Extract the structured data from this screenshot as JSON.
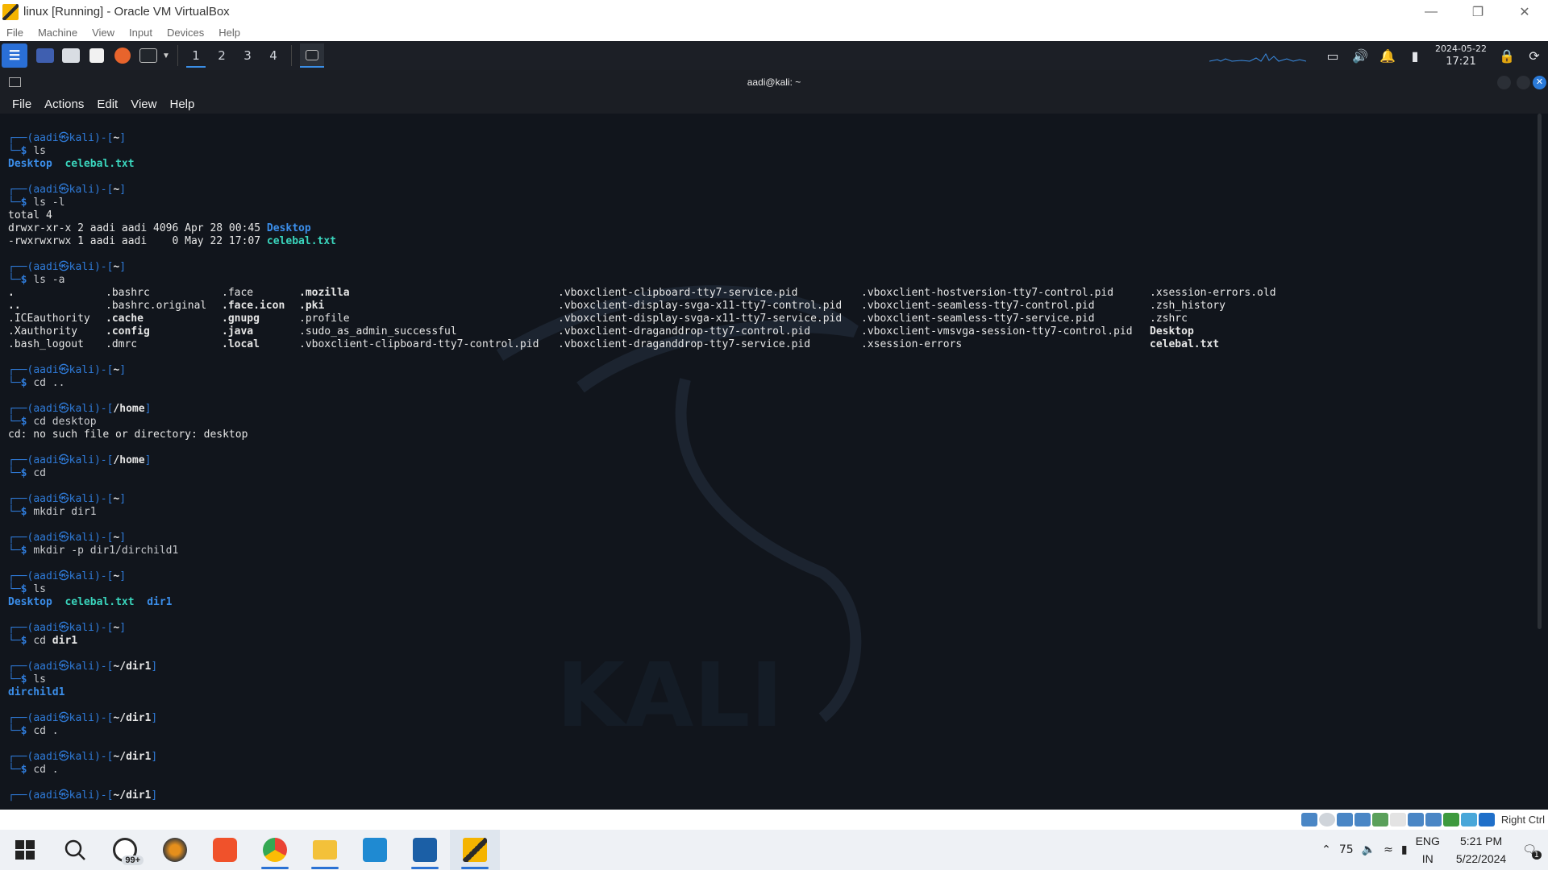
{
  "vbox": {
    "title": "linux [Running] - Oracle VM VirtualBox",
    "menu": [
      "File",
      "Machine",
      "View",
      "Input",
      "Devices",
      "Help"
    ],
    "host_key": "Right Ctrl"
  },
  "kali_panel": {
    "workspaces": [
      "1",
      "2",
      "3",
      "4"
    ],
    "date": "2024-05-22",
    "time": "17:21"
  },
  "terminal": {
    "title": "aadi@kali: ~",
    "menu": [
      "File",
      "Actions",
      "Edit",
      "View",
      "Help"
    ],
    "lines": [
      {
        "type": "prompt",
        "path": "~"
      },
      {
        "type": "cmd",
        "text": "ls"
      },
      {
        "type": "out_ls1"
      },
      {
        "type": "blank"
      },
      {
        "type": "prompt",
        "path": "~"
      },
      {
        "type": "cmd",
        "text": "ls -l"
      },
      {
        "type": "text",
        "text": "total 4"
      },
      {
        "type": "ll1",
        "text": "drwxr-xr-x 2 aadi aadi 4096 Apr 28 00:45 ",
        "name": "Desktop"
      },
      {
        "type": "ll2",
        "text": "-rwxrwxrwx 1 aadi aadi    0 May 22 17:07 ",
        "name": "celebal.txt"
      },
      {
        "type": "blank"
      },
      {
        "type": "prompt",
        "path": "~"
      },
      {
        "type": "cmd",
        "text": "ls -a"
      }
    ],
    "ls_a": {
      "c1": [
        ".",
        "..",
        ".ICEauthority",
        ".Xauthority",
        ".bash_logout"
      ],
      "c2": [
        ".bashrc",
        ".bashrc.original",
        ".cache",
        ".config",
        ".dmrc"
      ],
      "c3": [
        ".face",
        ".face.icon",
        ".gnupg",
        ".java",
        ".local"
      ],
      "c4": [
        ".mozilla",
        ".pki",
        ".profile",
        ".sudo_as_admin_successful",
        ".vboxclient-clipboard-tty7-control.pid"
      ],
      "c5": [
        ".vboxclient-clipboard-tty7-service.pid",
        ".vboxclient-display-svga-x11-tty7-control.pid",
        ".vboxclient-display-svga-x11-tty7-service.pid",
        ".vboxclient-draganddrop-tty7-control.pid",
        ".vboxclient-draganddrop-tty7-service.pid"
      ],
      "c6": [
        ".vboxclient-hostversion-tty7-control.pid",
        ".vboxclient-seamless-tty7-control.pid",
        ".vboxclient-seamless-tty7-service.pid",
        ".vboxclient-vmsvga-session-tty7-control.pid",
        ".xsession-errors"
      ],
      "c7": [
        ".xsession-errors.old",
        ".zsh_history",
        ".zshrc",
        "Desktop",
        "celebal.txt"
      ]
    },
    "history2": [
      {
        "path": "~",
        "cmd": "cd ..",
        "out": ""
      },
      {
        "path": "/home",
        "cmd": "cd desktop",
        "out": "cd: no such file or directory: desktop"
      },
      {
        "path": "/home",
        "cmd": "cd",
        "out": ""
      },
      {
        "path": "~",
        "cmd": "mkdir dir1",
        "out": ""
      },
      {
        "path": "~",
        "cmd": "mkdir -p dir1/dirchild1",
        "out": ""
      }
    ],
    "ls2": [
      "Desktop",
      "celebal.txt",
      "dir1"
    ],
    "cd_dir1": "dir1",
    "history3": [
      {
        "path": "~/dir1",
        "cmd": "ls",
        "out": "dirchild1"
      },
      {
        "path": "~/dir1",
        "cmd": "cd .",
        "out": ""
      },
      {
        "path": "~/dir1",
        "cmd": "cd .",
        "out": ""
      },
      {
        "path": "~/dir1",
        "cmd": "",
        "out": ""
      }
    ],
    "user": "aadi",
    "host": "kali",
    "watermark": "KALI"
  },
  "taskbar": {
    "whatsapp_badge": "99+",
    "battery": "75",
    "lang1": "ENG",
    "lang2": "IN",
    "time": "5:21 PM",
    "date": "5/22/2024",
    "notif_count": "1"
  }
}
